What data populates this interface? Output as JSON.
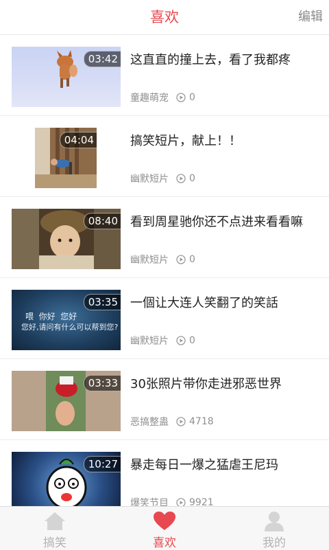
{
  "header": {
    "title": "喜欢",
    "edit_label": "编辑"
  },
  "videos": [
    {
      "duration": "03:42",
      "title": "这直直的撞上去，看了我都疼",
      "category": "童趣萌宠",
      "views": "0"
    },
    {
      "duration": "04:04",
      "title": "搞笑短片，献上！！",
      "category": "幽默短片",
      "views": "0"
    },
    {
      "duration": "08:40",
      "title": "看到周星驰你还不点进来看看嘛",
      "category": "幽默短片",
      "views": "0"
    },
    {
      "duration": "03:35",
      "title": "一個让大连人笑翻了的笑話",
      "category": "幽默短片",
      "views": "0",
      "thumb_caption_1": "喂  你好  您好",
      "thumb_caption_2": "您好,请问有什么可以帮到您?"
    },
    {
      "duration": "03:33",
      "title": "30张照片带你走进邪恶世界",
      "category": "恶搞整蛊",
      "views": "4718"
    },
    {
      "duration": "10:27",
      "title": "暴走每日一爆之猛虐王尼玛",
      "category": "爆笑节目",
      "views": "9921"
    }
  ],
  "tabbar": {
    "tabs": [
      {
        "label": "搞笑",
        "icon": "home-icon"
      },
      {
        "label": "喜欢",
        "icon": "heart-icon"
      },
      {
        "label": "我的",
        "icon": "user-icon"
      }
    ]
  },
  "colors": {
    "accent": "#e8484f",
    "inactive": "#b3b3b3",
    "text": "#222222",
    "meta": "#8f8f8f"
  }
}
